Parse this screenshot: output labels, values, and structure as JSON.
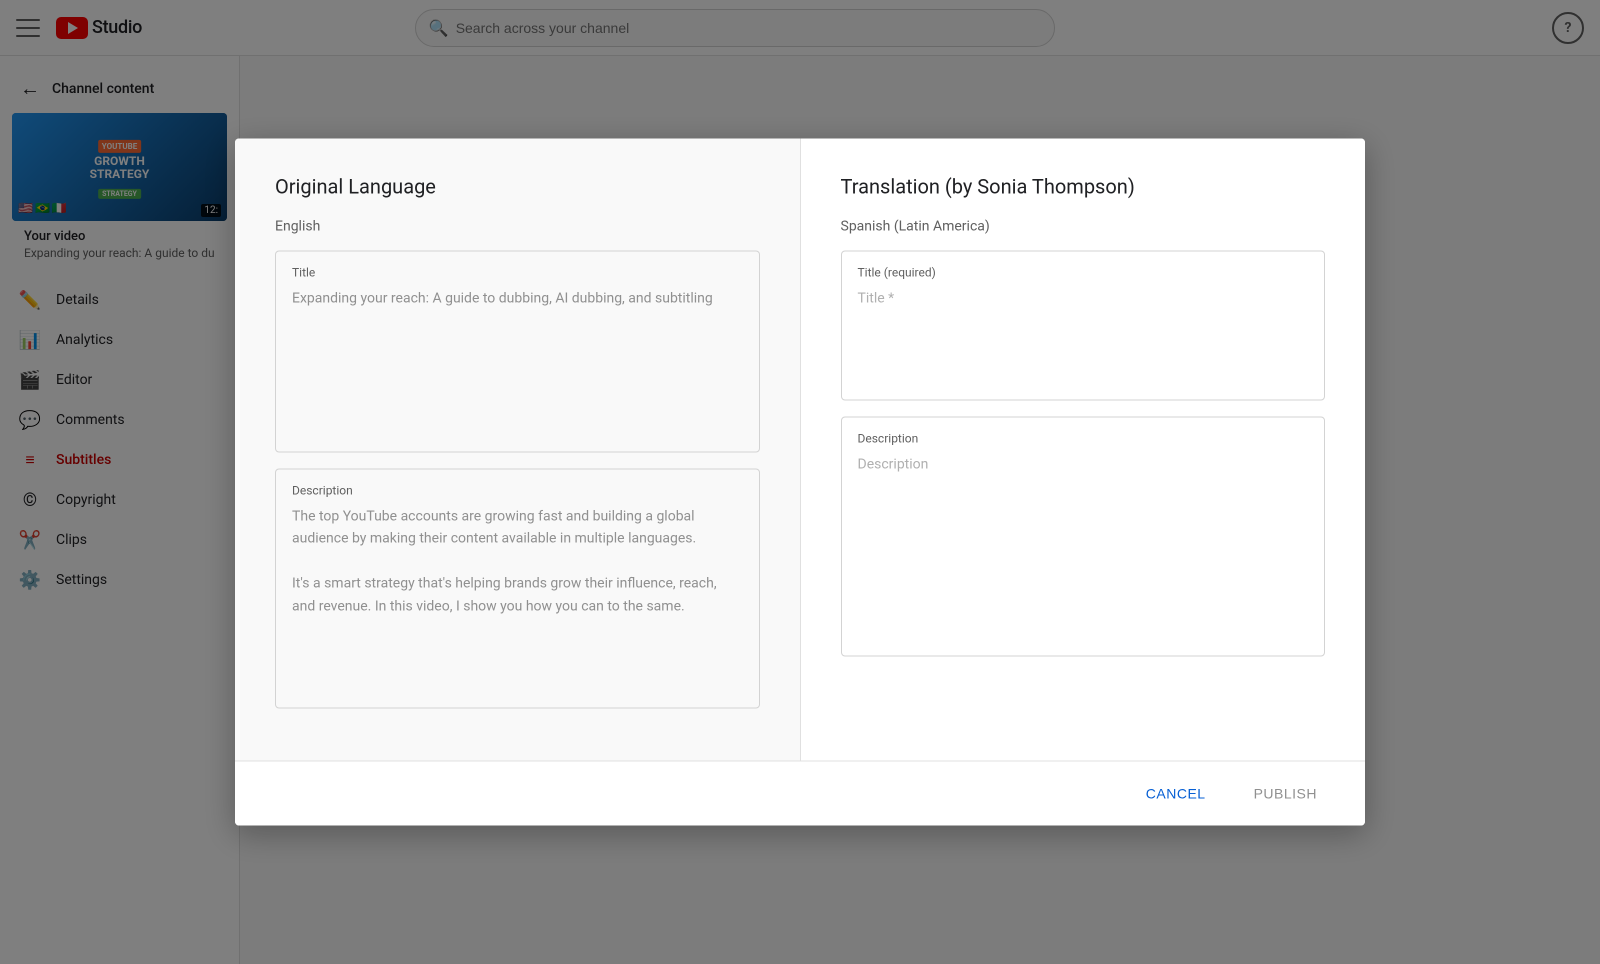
{
  "topnav": {
    "logo_text": "Studio",
    "search_placeholder": "Search across your channel",
    "help_label": "?"
  },
  "sidebar": {
    "back_label": "Channel content",
    "your_video_label": "Your video",
    "your_video_title": "Expanding your reach: A guide to du",
    "duration": "12:",
    "nav_items": [
      {
        "id": "details",
        "label": "Details",
        "icon": "✏️"
      },
      {
        "id": "analytics",
        "label": "Analytics",
        "icon": "📊"
      },
      {
        "id": "editor",
        "label": "Editor",
        "icon": "🎬"
      },
      {
        "id": "comments",
        "label": "Comments",
        "icon": "💬"
      },
      {
        "id": "subtitles",
        "label": "Subtitles",
        "icon": "≡",
        "active": true
      },
      {
        "id": "copyright",
        "label": "Copyright",
        "icon": "©"
      },
      {
        "id": "clips",
        "label": "Clips",
        "icon": "✂️"
      },
      {
        "id": "settings",
        "label": "Settings",
        "icon": "⚙️"
      }
    ]
  },
  "modal": {
    "left_title": "Original Language",
    "left_lang": "English",
    "right_title": "Translation (by Sonia Thompson)",
    "right_lang": "Spanish (Latin America)",
    "title_label": "Title",
    "title_content": "Expanding your reach: A guide to dubbing, AI dubbing, and subtitling",
    "description_label": "Description",
    "description_content": "The top YouTube accounts are growing fast and building a global audience by making their content available in multiple languages.\n\nIt's a smart strategy that's helping brands grow their influence, reach, and revenue. In this video, I show you how you can to the same.",
    "right_title_label": "Title (required)",
    "right_title_placeholder": "Title *",
    "right_description_label": "Description",
    "right_description_placeholder": "Description"
  },
  "footer": {
    "cancel_label": "CANCEL",
    "publish_label": "PUBLISH"
  }
}
